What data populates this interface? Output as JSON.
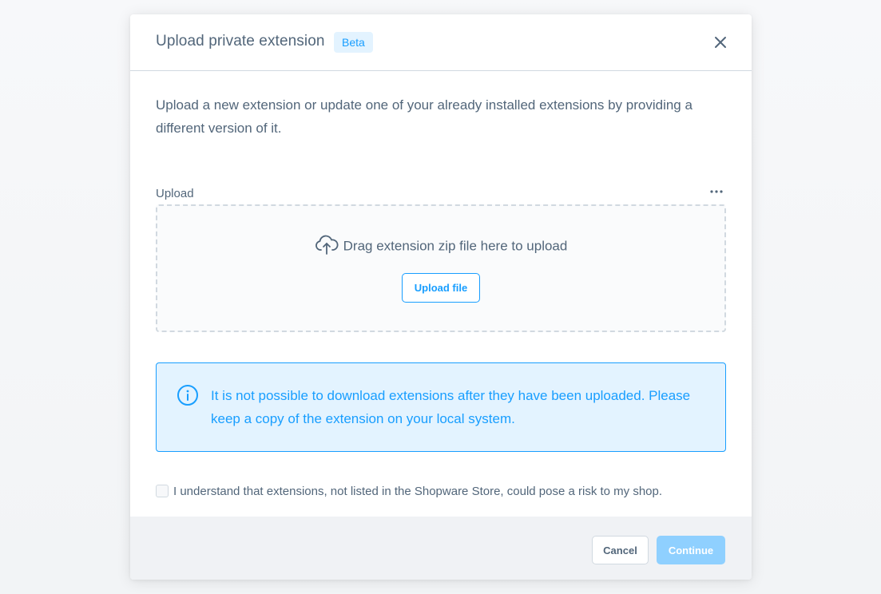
{
  "modal": {
    "title": "Upload private extension",
    "badge": "Beta",
    "description": "Upload a new extension or update one of your already installed extensions by providing a different version of it.",
    "upload": {
      "label": "Upload",
      "drop_text": "Drag extension zip file here to upload",
      "button_label": "Upload file"
    },
    "info": {
      "text": "It is not possible to download extensions after they have been uploaded. Please keep a copy of the extension on your local system."
    },
    "consent": {
      "label": "I understand that extensions, not listed in the Shopware Store, could pose a risk to my shop.",
      "checked": false
    },
    "footer": {
      "cancel_label": "Cancel",
      "continue_label": "Continue"
    }
  },
  "colors": {
    "accent": "#189eff",
    "info_background": "#e3f3ff",
    "text": "#52667a",
    "border": "#d1d9e0",
    "continue_disabled": "#8fd0ff"
  },
  "icons": {
    "close": "close-icon",
    "more": "more-icon",
    "cloud_upload": "cloud-upload-icon",
    "info": "info-icon"
  }
}
